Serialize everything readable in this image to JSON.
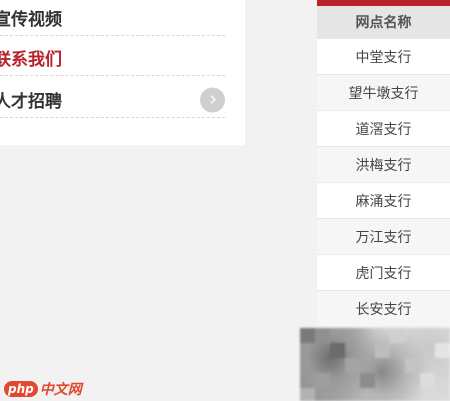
{
  "left_menu": {
    "items": [
      {
        "label": "宣传视频",
        "active": false
      },
      {
        "label": "联系我们",
        "active": true
      },
      {
        "label": "人才招聘",
        "active": false
      }
    ],
    "chevron_icon": "chevron-right-icon"
  },
  "branch_table": {
    "header": "网点名称",
    "rows": [
      "中堂支行",
      "望牛墩支行",
      "道滘支行",
      "洪梅支行",
      "麻涌支行",
      "万江支行",
      "虎门支行",
      "长安支行"
    ]
  },
  "watermark": {
    "badge": "php",
    "text": "中文网"
  },
  "colors": {
    "accent_red": "#b8232a",
    "logo_red": "#e2472f"
  }
}
